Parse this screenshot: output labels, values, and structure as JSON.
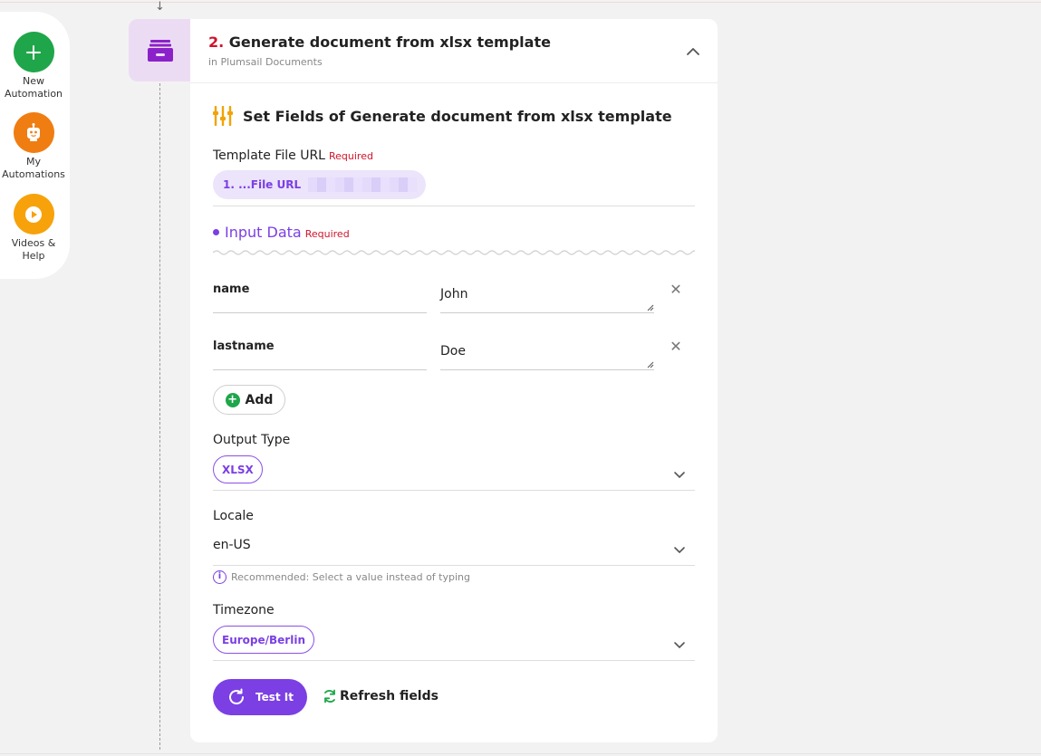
{
  "sidebar": {
    "items": [
      {
        "label_line1": "New",
        "label_line2": "Automation",
        "icon": "plus-icon",
        "color": "#1fa64a"
      },
      {
        "label_line1": "My",
        "label_line2": "Automations",
        "icon": "robot-icon",
        "color": "#f07d12"
      },
      {
        "label_line1": "Videos &",
        "label_line2": "Help",
        "icon": "play-icon",
        "color": "#f7a20a"
      }
    ]
  },
  "step": {
    "number": "2.",
    "title": "Generate document from xlsx template",
    "subtitle": "in Plumsail Documents",
    "icon": "archive-box-icon",
    "icon_color": "#8b22c9"
  },
  "section": {
    "title": "Set Fields of Generate document from xlsx template",
    "icon": "sliders-icon",
    "icon_color": "#f0a406"
  },
  "fields": {
    "template_url": {
      "label": "Template File URL",
      "required": "Required",
      "value": "1. ...File URL"
    },
    "input_data": {
      "label": "Input Data",
      "required": "Required",
      "rows": [
        {
          "key": "name",
          "value": "John"
        },
        {
          "key": "lastname",
          "value": "Doe"
        }
      ],
      "add_label": "Add"
    },
    "output_type": {
      "label": "Output Type",
      "value": "XLSX"
    },
    "locale": {
      "label": "Locale",
      "value": "en-US",
      "hint": "Recommended: Select a value instead of typing"
    },
    "timezone": {
      "label": "Timezone",
      "value": "Europe/Berlin"
    }
  },
  "actions": {
    "test_label": "Test It",
    "refresh_label": "Refresh fields"
  },
  "colors": {
    "accent": "#7b3fe4",
    "required": "#d0142c",
    "success": "#1fa64a"
  }
}
